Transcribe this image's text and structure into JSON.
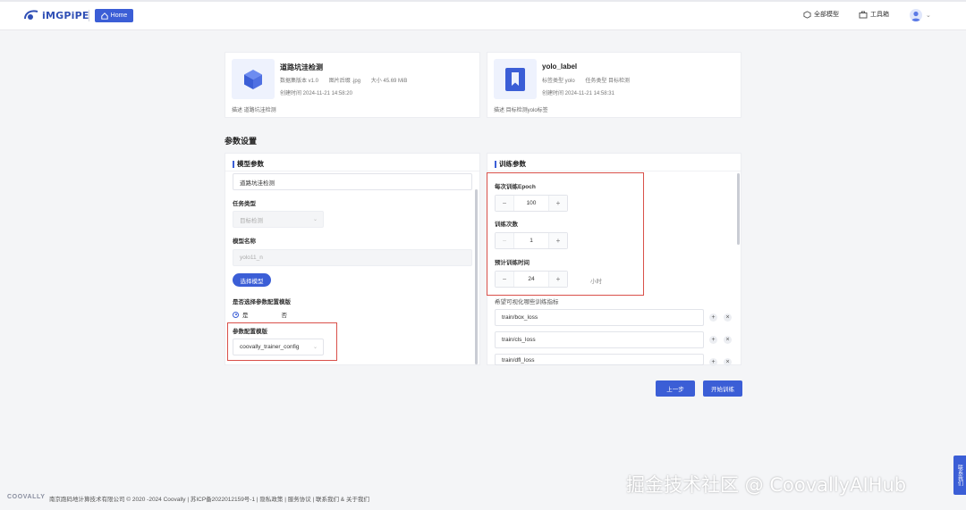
{
  "app": {
    "logo_text": "iMGPiPE",
    "home_label": "Home",
    "nav_models": "全部模型",
    "nav_tools": "工具箱"
  },
  "dataset_card": {
    "title": "道路坑洼检测",
    "version": "数据集版本 v1.0",
    "image_format": "图片后缀 .jpg",
    "size": "大小 45.69 MiB",
    "created": "创建时间 2024-11-21 14:58:20",
    "desc": "描述 道路坑洼检测"
  },
  "label_card": {
    "title": "yolo_label",
    "label_type": "标签类型 yolo",
    "task_type": "任务类型 目标检测",
    "created": "创建时间 2024-11-21 14:58:31",
    "desc": "描述 目标检测yolo标签"
  },
  "section_title": "参数设置",
  "model_panel": {
    "title": "模型参数",
    "name_value": "道路坑洼检测",
    "task_label": "任务类型",
    "task_value": "目标检测",
    "model_name_label": "模型名称",
    "model_name_value": "yolo11_n",
    "choose_model_btn": "选择模型",
    "template_question": "是否选择参数配置模版",
    "radio_yes": "是",
    "radio_no": "否",
    "template_label": "参数配置模版",
    "template_value": "coovally_trainer_config"
  },
  "train_panel": {
    "title": "训练参数",
    "epoch_label": "每次训练Epoch",
    "epoch_value": "100",
    "times_label": "训练次数",
    "times_value": "1",
    "time_label": "预计训练时间",
    "time_value": "24",
    "time_unit": "小时",
    "metrics_label": "希望可视化哪些训练指标",
    "metrics": [
      "train/box_loss",
      "train/cls_loss",
      "train/dfl_loss"
    ]
  },
  "buttons": {
    "prev": "上一步",
    "start": "开始训练"
  },
  "footer": {
    "brand": "COOVALLY",
    "text": "南京跑码地计算技术有限公司 © 2020 -2024 Coovally | 苏ICP备2022012159号-1 | 隐私政策 | 服务协议 | 联系我们 & 关于我们"
  },
  "watermark": "掘金技术社区 @ CoovallyAIHub",
  "contact_tab": "联系我们",
  "colors": {
    "accent": "#3b5ed6",
    "highlight": "#d9504a"
  }
}
